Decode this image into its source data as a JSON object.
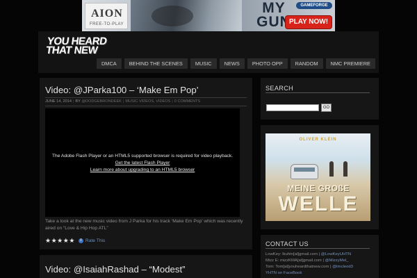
{
  "ad": {
    "logo_main": "AION",
    "logo_sub": "FREE-TO-PLAY",
    "headline_line1": "MY",
    "headline_line2": "GUN",
    "brand": "GAMEFORGE",
    "cta": "PLAY NOW!"
  },
  "header": {
    "logo_line1": "YOU HEARD",
    "logo_line2": "THAT NEW",
    "nav": [
      "DMCA",
      "BEHIND THE SCENES",
      "MUSIC",
      "NEWS",
      "PHOTO OPP",
      "RANDOM",
      "NMC PREMIERE"
    ]
  },
  "post1": {
    "title": "Video: @JParka100 – ‘Make Em Pop’",
    "meta_date": "JUNE 14, 2014",
    "meta_by": "BY",
    "meta_author": "@DODGEBRONDEEK",
    "meta_cat1": "MUSIC VIDEOS",
    "meta_cat2": "VIDEOS",
    "meta_comments": "0 COMMENTS",
    "video_msg": "The Adobe Flash Player or an HTML5 supported browser is required for video playback.",
    "video_link1": "Get the latest Flash Player",
    "video_link2": "Learn more about upgrading to an HTML5 browser",
    "excerpt": "Take a look at the new music video from J Parka for his track ‘Make Em Pop’ which was recently aired on “Love & Hip Hop ATL”",
    "rating_stars": 5,
    "rate_label": "Rate This"
  },
  "post2": {
    "title": "Video: @IsaiahRashad – “Modest”"
  },
  "sidebar": {
    "search_title": "SEARCH",
    "search_placeholder": "",
    "search_button": "GO",
    "promo_artist": "OLIVER KLEIN",
    "promo_line1": "MEINE GROßE",
    "promo_line2": "WELLE",
    "contact_title": "CONTACT US",
    "contacts": [
      {
        "text": "LowKey: lkuhtn[at]gmail.com |",
        "handle": "@LowKeyUHTN"
      },
      {
        "text": "Mizz E: mizzKMA[at]gmail.com |",
        "handle": "@MizzyMel_"
      },
      {
        "text": "Tom: Tom[at]youheardthatnew.com |",
        "handle": "@tmcleod3"
      },
      {
        "text": "",
        "handle": "YHTN on FaceBook"
      }
    ]
  },
  "colors": {
    "background": "#050505",
    "panel": "#161616",
    "nav_bg": "#2a2a2a",
    "link": "#7592bd",
    "ad_cta": "#d8231b"
  },
  "icons": {
    "star": "star-icon",
    "info": "info-icon"
  }
}
